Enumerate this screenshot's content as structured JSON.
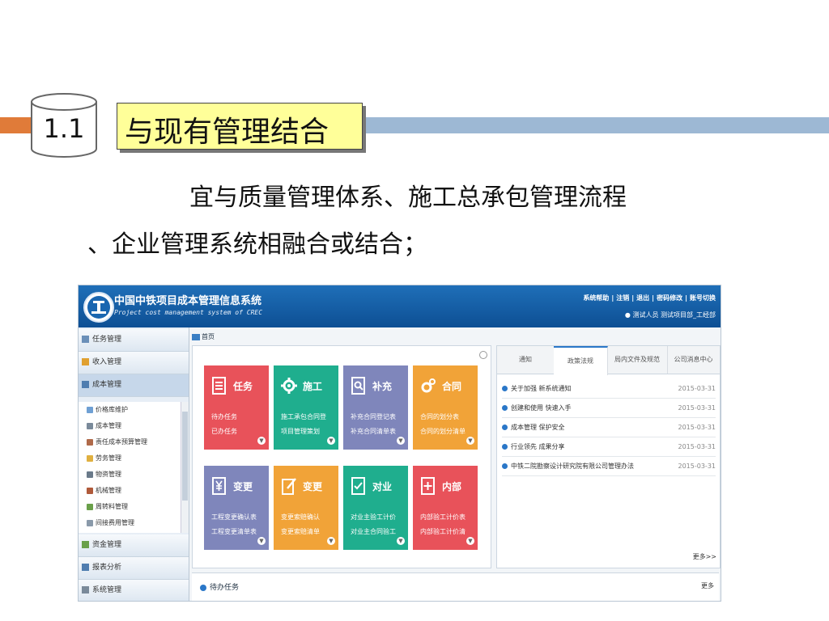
{
  "slide": {
    "section_number": "1.1",
    "title": "与现有管理结合",
    "body_line1": "宜与质量管理体系、施工总承包管理流程",
    "body_line2": "、企业管理系统相融合或结合；"
  },
  "app": {
    "title": "中国中铁项目成本管理信息系统",
    "subtitle": "Project cost management system of CREC",
    "top_links": [
      "系统帮助",
      "|",
      "注销",
      "|",
      "退出",
      "|",
      "密码修改",
      "|",
      "账号切换"
    ],
    "user": "测试人员  测试项目部_工经部",
    "breadcrumb": "首页",
    "sidebar": {
      "items": [
        "任务管理",
        "收入管理",
        "成本管理"
      ],
      "sub_items": [
        "价格库维护",
        "成本管理",
        "责任成本预算管理",
        "劳务管理",
        "物资管理",
        "机械管理",
        "周转料管理",
        "间接费用管理"
      ],
      "bottom_items": [
        "资金管理",
        "报表分析",
        "系统管理"
      ]
    },
    "tiles": [
      {
        "title": "任务",
        "line1": "待办任务",
        "line2": "已办任务",
        "color": "#e8525a"
      },
      {
        "title": "施工",
        "line1": "施工承包合同登",
        "line2": "项目管理策划",
        "color": "#1fae8e"
      },
      {
        "title": "补充",
        "line1": "补充合同登记表",
        "line2": "补充合同清单表",
        "color": "#7f86bb"
      },
      {
        "title": "合同",
        "line1": "合同的划分表",
        "line2": "合同的划分清单",
        "color": "#f1a338"
      },
      {
        "title": "变更",
        "line1": "工程变更确认表",
        "line2": "工程变更清单表",
        "color": "#7f86bb"
      },
      {
        "title": "变更",
        "line1": "变更索赔确认",
        "line2": "变更索赔清单",
        "color": "#f1a338"
      },
      {
        "title": "对业",
        "line1": "对业主验工计价",
        "line2": "对业主合同验工",
        "color": "#1fae8e"
      },
      {
        "title": "内部",
        "line1": "内部验工计价表",
        "line2": "内部验工计价清",
        "color": "#e8525a"
      }
    ],
    "news_tabs": [
      "通知",
      "政策法规",
      "局内文件及规范",
      "公司消息中心"
    ],
    "news": [
      {
        "title": "关于加强  新系统通知",
        "date": "2015-03-31"
      },
      {
        "title": "创建和使用  快速入手",
        "date": "2015-03-31"
      },
      {
        "title": "成本管理  保护安全",
        "date": "2015-03-31"
      },
      {
        "title": "行业领先  成果分享",
        "date": "2015-03-31"
      },
      {
        "title": "中铁二院勘察设计研究院有限公司管理办法",
        "date": "2015-03-31"
      }
    ],
    "more": "更多>>",
    "todo_label": "待办任务",
    "todo_more": "更多"
  },
  "colors": {
    "orange_bar": "#e07b39",
    "blue_bar": "#9db8d4",
    "title_bg": "#ffff99",
    "header_blue": "#1a66b0"
  }
}
